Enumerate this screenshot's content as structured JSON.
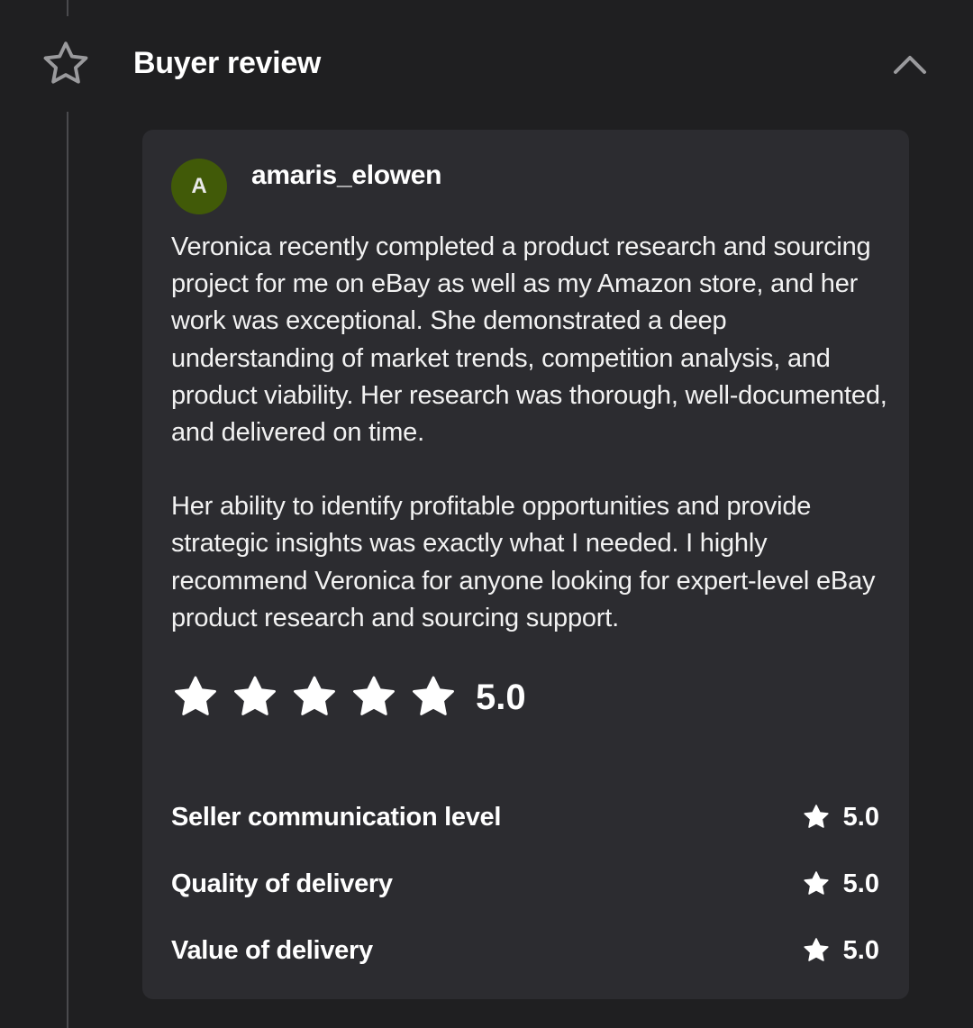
{
  "section": {
    "title": "Buyer review",
    "icon": "star-outline-icon",
    "toggle_icon": "chevron-up-icon"
  },
  "review": {
    "avatar_initial": "A",
    "avatar_color": "#415a08",
    "username": "amaris_elowen",
    "paragraphs": [
      "Veronica recently completed a product research and sourcing project for me on eBay as well as my Amazon store, and her work was exceptional. She demonstrated a deep understanding of market trends, competition analysis, and product viability. Her research was thorough, well-documented, and delivered on time.",
      "Her ability to identify profitable opportunities and provide strategic insights was exactly what I needed. I highly recommend Veronica for anyone looking for expert-level eBay product research and sourcing support."
    ],
    "rating": {
      "stars_filled": 5,
      "stars_total": 5,
      "score": "5.0"
    },
    "sub_ratings": [
      {
        "label": "Seller communication level",
        "score": "5.0"
      },
      {
        "label": "Quality of delivery",
        "score": "5.0"
      },
      {
        "label": "Value of delivery",
        "score": "5.0"
      }
    ]
  },
  "colors": {
    "background": "#1f1f21",
    "card": "#2c2c30",
    "text": "#ffffff",
    "muted_icon": "#9a9a9d"
  }
}
